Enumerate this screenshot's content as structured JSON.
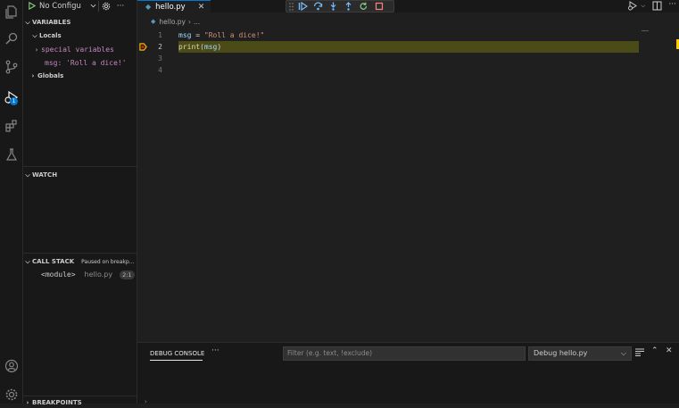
{
  "debug": {
    "config_label": "No Configu"
  },
  "sidebar": {
    "variables_title": "VARIABLES",
    "locals_label": "Locals",
    "special_vars_label": "special variables",
    "msg_var": "msg: 'Roll a dice!'",
    "globals_label": "Globals",
    "watch_title": "WATCH",
    "callstack_title": "CALL STACK",
    "callstack_status": "Paused on breakp...",
    "frame_name": "<module>",
    "frame_file": "hello.py",
    "frame_line": "2:1",
    "breakpoints_title": "BREAKPOINTS"
  },
  "activity": {
    "run_badge": "1"
  },
  "editor": {
    "tab_label": "hello.py",
    "breadcrumb_file": "hello.py",
    "breadcrumb_more": "...",
    "lines": [
      {
        "num": "1",
        "tokens": [
          "msg",
          " = ",
          "\"Roll a dice!\""
        ]
      },
      {
        "num": "2",
        "tokens": [
          "print",
          "(",
          "msg",
          ")"
        ]
      },
      {
        "num": "3"
      },
      {
        "num": "4"
      }
    ]
  },
  "panel": {
    "tab_label": "DEBUG CONSOLE",
    "filter_placeholder": "Filter (e.g. text, !exclude)",
    "target_value": "Debug hello.py"
  },
  "colors": {
    "accent": "#0078d4",
    "current_line": "#4b4b18",
    "breakpoint": "#ffcc00"
  }
}
